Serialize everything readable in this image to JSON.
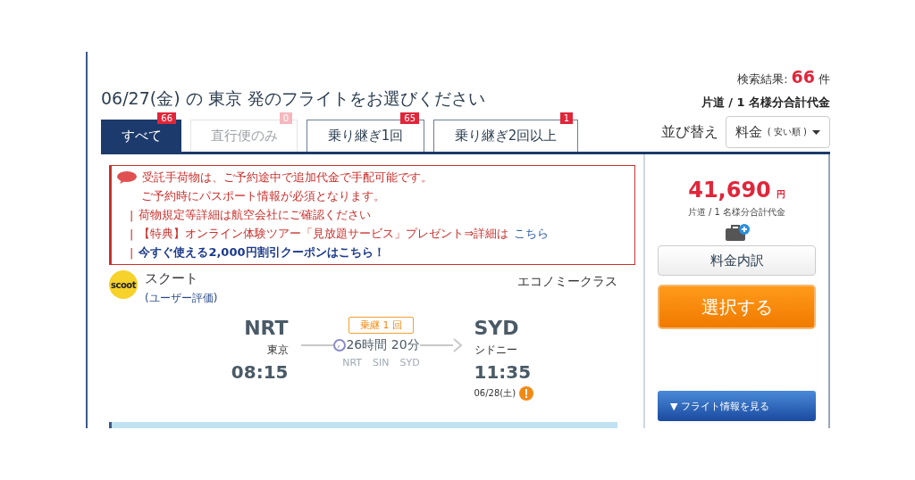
{
  "results": {
    "label": "検索結果:",
    "count": "66",
    "unit": "件"
  },
  "title": {
    "date": "06/27(金)",
    "particle": "の",
    "city": "東京",
    "rest": "発のフライトをお選びください"
  },
  "price_basis": "片道 / 1 名様分合計代金",
  "tabs": [
    {
      "label": "すべて",
      "count": "66",
      "selected": true,
      "disabled": false
    },
    {
      "label": "直行便のみ",
      "count": "0",
      "selected": false,
      "disabled": true
    },
    {
      "label": "乗り継ぎ1回",
      "count": "65",
      "selected": false,
      "disabled": false
    },
    {
      "label": "乗り継ぎ2回以上",
      "count": "1",
      "selected": false,
      "disabled": false
    }
  ],
  "sort": {
    "label": "並び替え",
    "value": "料金",
    "hint": "( 安い順 )"
  },
  "notice": {
    "lines": [
      {
        "kind": "lead",
        "text": "受託手荷物は、ご予約途中で追加代金で手配可能です。"
      },
      {
        "kind": "plain",
        "text": "ご予約時にパスポート情報が必須となります。"
      },
      {
        "kind": "bullet",
        "marker": "|",
        "text": "荷物規定等詳細は航空会社にご確認ください"
      },
      {
        "kind": "bullet",
        "marker": "|",
        "text": "【特典】オンライン体験ツアー「見放題サービス」プレゼント⇒詳細は",
        "link": "こちら"
      },
      {
        "kind": "bullet",
        "marker": "|",
        "link": "今すぐ使える2,000円割引クーポンはこちら！"
      }
    ]
  },
  "flight": {
    "logo": "scoot",
    "airline": "スクート",
    "rating": "(ユーザー評価)",
    "cabin": "エコノミークラス",
    "origin": {
      "code": "NRT",
      "city": "東京",
      "time": "08:15"
    },
    "stops_badge": "乗継 1 回",
    "duration": "26時間 20分",
    "route": [
      "NRT",
      "SIN",
      "SYD"
    ],
    "destination": {
      "code": "SYD",
      "city": "シドニー",
      "time": "11:35",
      "date": "06/28(土)",
      "warning": true
    }
  },
  "fare": {
    "amount": "41,690",
    "unit": "円",
    "note": "片道 / 1 名様分合計代金",
    "baggage_addon": true,
    "breakdown_button": "料金内訳",
    "select_button": "選択する",
    "details_button": "▼ フライト情報を見る"
  }
}
